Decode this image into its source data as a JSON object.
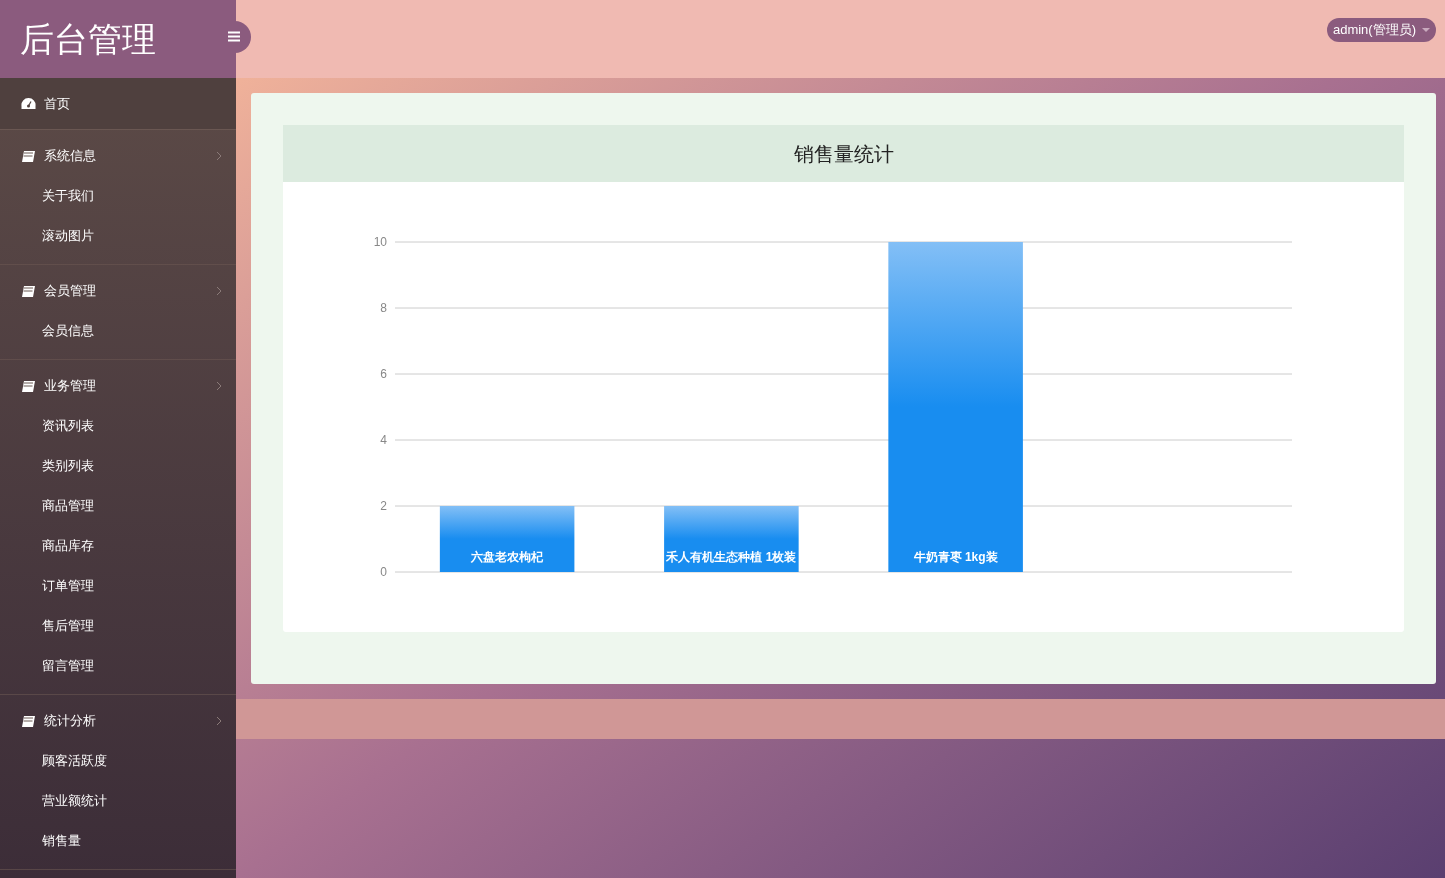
{
  "sidebar": {
    "logo": "后台管理",
    "home": {
      "label": "首页"
    },
    "groups": [
      {
        "label": "系统信息",
        "children": [
          {
            "label": "关于我们"
          },
          {
            "label": "滚动图片"
          }
        ]
      },
      {
        "label": "会员管理",
        "children": [
          {
            "label": "会员信息"
          }
        ]
      },
      {
        "label": "业务管理",
        "children": [
          {
            "label": "资讯列表"
          },
          {
            "label": "类别列表"
          },
          {
            "label": "商品管理"
          },
          {
            "label": "商品库存"
          },
          {
            "label": "订单管理"
          },
          {
            "label": "售后管理"
          },
          {
            "label": "留言管理"
          }
        ]
      },
      {
        "label": "统计分析",
        "children": [
          {
            "label": "顾客活跃度"
          },
          {
            "label": "营业额统计"
          },
          {
            "label": "销售量"
          }
        ]
      }
    ]
  },
  "header": {
    "user": "admin(管理员)"
  },
  "panel": {
    "title": "销售量统计",
    "chart_data": {
      "type": "bar",
      "categories": [
        "六盘老农枸杞",
        "禾人有机生态种植 1枚装",
        "牛奶青枣 1kg装"
      ],
      "values": [
        2,
        2,
        10
      ],
      "ylim": [
        0,
        10
      ],
      "yticks": [
        0,
        2,
        4,
        6,
        8,
        10
      ],
      "data_labels": false,
      "grid": true
    }
  }
}
